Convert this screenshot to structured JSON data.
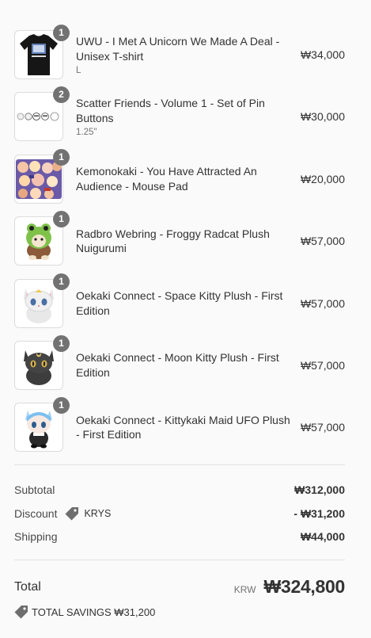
{
  "items": [
    {
      "name": "UWU - I Met A Unicorn We Made A Deal - Unisex T-shirt",
      "variant": "L",
      "qty": "1",
      "price": "₩34,000",
      "icon": "tshirt-image"
    },
    {
      "name": "Scatter Friends - Volume 1 - Set of Pin Buttons",
      "variant": "1.25\"",
      "qty": "2",
      "price": "₩30,000",
      "icon": "pin-buttons-image"
    },
    {
      "name": "Kemonokaki - You Have Attracted An Audience - Mouse Pad",
      "variant": "",
      "qty": "1",
      "price": "₩20,000",
      "icon": "mouse-pad-image"
    },
    {
      "name": "Radbro Webring - Froggy Radcat Plush Nuigurumi",
      "variant": "",
      "qty": "1",
      "price": "₩57,000",
      "icon": "froggy-plush-image"
    },
    {
      "name": "Oekaki Connect - Space Kitty Plush - First Edition",
      "variant": "",
      "qty": "1",
      "price": "₩57,000",
      "icon": "space-kitty-plush-image"
    },
    {
      "name": "Oekaki Connect - Moon Kitty Plush - First Edition",
      "variant": "",
      "qty": "1",
      "price": "₩57,000",
      "icon": "moon-kitty-plush-image"
    },
    {
      "name": "Oekaki Connect - Kittykaki Maid UFO Plush - First Edition",
      "variant": "",
      "qty": "1",
      "price": "₩57,000",
      "icon": "maid-ufo-plush-image"
    }
  ],
  "summary": {
    "subtotal_label": "Subtotal",
    "subtotal_value": "₩312,000",
    "discount_label": "Discount",
    "discount_code": "KRYS",
    "discount_value": "- ₩31,200",
    "shipping_label": "Shipping",
    "shipping_value": "₩44,000"
  },
  "total": {
    "label": "Total",
    "currency": "KRW",
    "amount": "₩324,800",
    "savings": "TOTAL SAVINGS ₩31,200"
  }
}
